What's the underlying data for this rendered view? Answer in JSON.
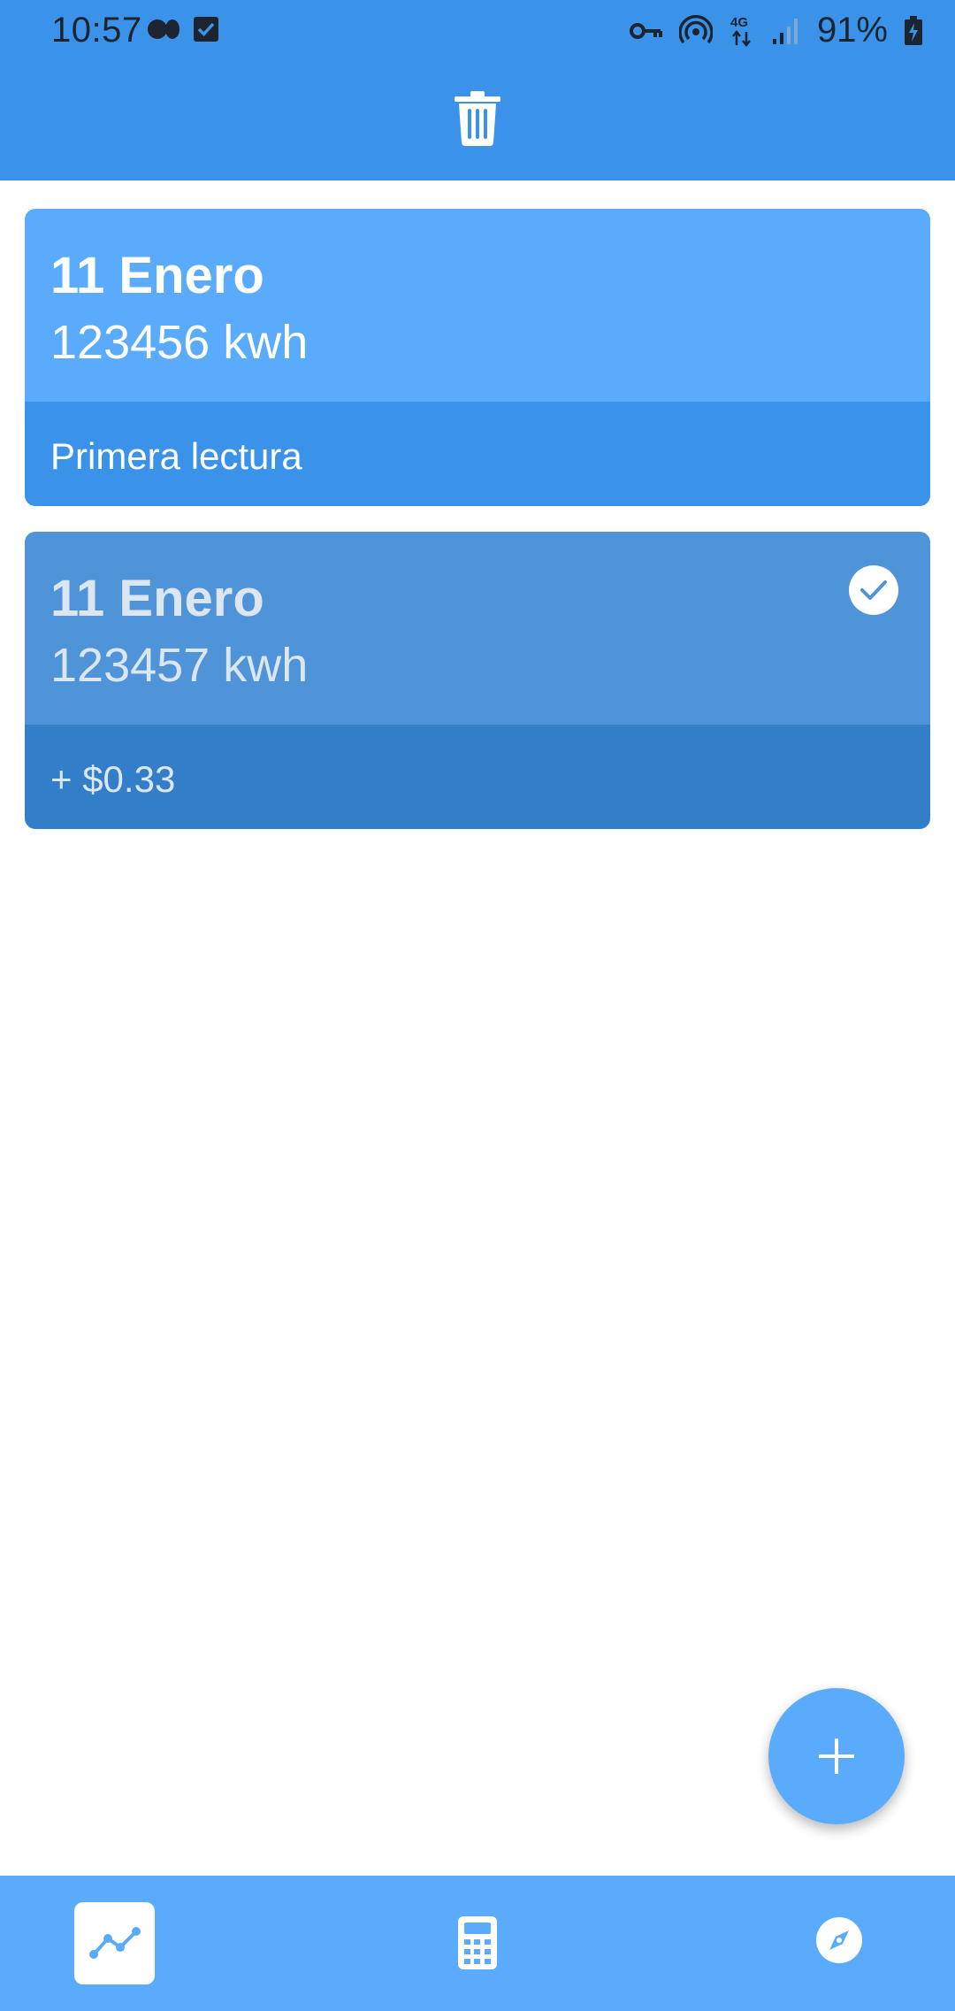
{
  "status_bar": {
    "time": "10:57",
    "battery_percent": "91%",
    "icons": [
      "media-icon",
      "checkbox-notification-icon",
      "vpn-key-icon",
      "hotspot-icon",
      "4g-data-icon",
      "signal-icon",
      "battery-charging-icon"
    ]
  },
  "header": {
    "action_icon": "trash-icon"
  },
  "readings": [
    {
      "date": "11 Enero",
      "value": "123456 kwh",
      "note": "Primera lectura",
      "selected": false
    },
    {
      "date": "11 Enero",
      "value": "123457 kwh",
      "note": "+ $0.33",
      "selected": true
    }
  ],
  "fab": {
    "icon": "plus-icon"
  },
  "bottom_nav": {
    "items": [
      {
        "icon": "chart-line-icon",
        "active": true
      },
      {
        "icon": "calculator-icon",
        "active": false
      },
      {
        "icon": "compass-icon",
        "active": false
      }
    ]
  },
  "colors": {
    "primary": "#3b93e9",
    "primary_light": "#5aabfb",
    "selected_card": "#4f93d8",
    "selected_card_dark": "#327ec9"
  }
}
